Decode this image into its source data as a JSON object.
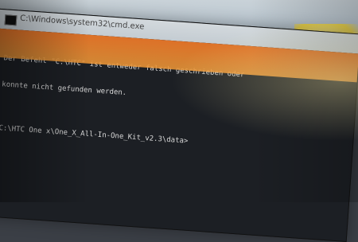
{
  "window": {
    "title": "C:\\Windows\\system32\\cmd.exe"
  },
  "console": {
    "lines": [
      "Der Befehl \"C:\\HTC\" ist entweder falsch geschrieben oder",
      "konnte nicht gefunden werden.",
      "",
      "C:\\HTC One x\\One_X_All-In-One_Kit_v2.3\\data>"
    ]
  },
  "colors": {
    "error_highlight": "#ee7828",
    "console_bg": "#1c1f24",
    "console_text": "#d8d8d8"
  },
  "icons": [
    "folder-icon",
    "globe-icon",
    "cmd-icon"
  ]
}
